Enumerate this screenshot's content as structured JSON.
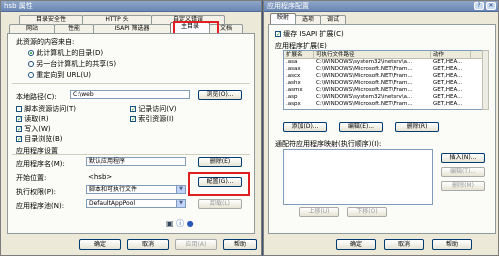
{
  "left_dialog": {
    "title": "hsb 属性",
    "top_tabs": [
      "目录安全性",
      "HTTP 头",
      "自定义错误"
    ],
    "bottom_tabs": [
      "网站",
      "性能",
      "ISAPI 筛选器",
      "主目录",
      "文档"
    ],
    "active_tab": "主目录",
    "content_source_label": "此资源的内容来自:",
    "radio_options": [
      "此计算机上的目录(D)",
      "另一台计算机上的共享(S)",
      "重定向到 URL(U)"
    ],
    "local_path_label": "本地路径(C):",
    "local_path_value": "C:\\web",
    "browse_button": "浏览(O)...",
    "checkboxes_left": [
      {
        "label": "脚本资源访问(T)",
        "checked": false
      },
      {
        "label": "读取(R)",
        "checked": true
      },
      {
        "label": "写入(W)",
        "checked": true
      },
      {
        "label": "目录浏览(B)",
        "checked": true
      }
    ],
    "checkboxes_right": [
      {
        "label": "记录访问(V)",
        "checked": true
      },
      {
        "label": "索引资源(I)",
        "checked": true
      }
    ],
    "app_settings_label": "应用程序设置",
    "app_name_label": "应用程序名(M):",
    "app_name_value": "默认应用程序",
    "remove_button": "删除(E)",
    "start_point_label": "开始位置:",
    "start_point_value": "<hsb>",
    "config_button": "配置(G)...",
    "exec_perm_label": "执行权限(P):",
    "exec_perm_value": "脚本和可执行文件",
    "app_pool_label": "应用程序池(N):",
    "app_pool_value": "DefaultAppPool",
    "unload_button": "卸载(L)",
    "ok_button": "确定",
    "cancel_button": "取消",
    "apply_button": "应用(A)",
    "help_button": "帮助"
  },
  "right_dialog": {
    "title": "应用程序配置",
    "tabs": [
      "映射",
      "选项",
      "调试"
    ],
    "active_tab": "映射",
    "cache_label": "缓存 ISAPI 扩展(C)",
    "cache_checked": true,
    "ext_group_label": "应用程序扩展(E)",
    "columns": [
      "扩展名",
      "可执行文件路径",
      "动作"
    ],
    "rows": [
      [
        ".asa",
        "C:\\WINDOWS\\system32\\inetsrv\\a...",
        "GET,HEA..."
      ],
      [
        ".asax",
        "C:\\WINDOWS\\Microsoft.NET\\Fram...",
        "GET,HEA..."
      ],
      [
        ".ascx",
        "C:\\WINDOWS\\Microsoft.NET\\Fram...",
        "GET,HEA..."
      ],
      [
        ".ashx",
        "C:\\WINDOWS\\Microsoft.NET\\Fram...",
        "GET,HEA..."
      ],
      [
        ".asmx",
        "C:\\WINDOWS\\Microsoft.NET\\Fram...",
        "GET,HEA..."
      ],
      [
        ".asp",
        "C:\\WINDOWS\\system32\\inetsrv\\a...",
        "GET,HEA..."
      ],
      [
        ".aspx",
        "C:\\WINDOWS\\Microsoft.NET\\Fram...",
        "GET,HEA..."
      ]
    ],
    "add_button": "添加(D)...",
    "edit_button": "编辑(E)...",
    "delete_button": "删除(R)",
    "wildcard_label": "通配符应用程序映射(执行顺序)(I):",
    "insert_button": "插入(N)...",
    "edit2_button": "编辑(T)...",
    "delete2_button": "删除(M)",
    "up_button": "上移(U)",
    "down_button": "下移(O)",
    "ok_button": "确定",
    "cancel_button": "取消",
    "help_button": "帮助"
  },
  "colors": {
    "highlight_box": "#e02020",
    "title_gradient": "#6a87b4"
  }
}
